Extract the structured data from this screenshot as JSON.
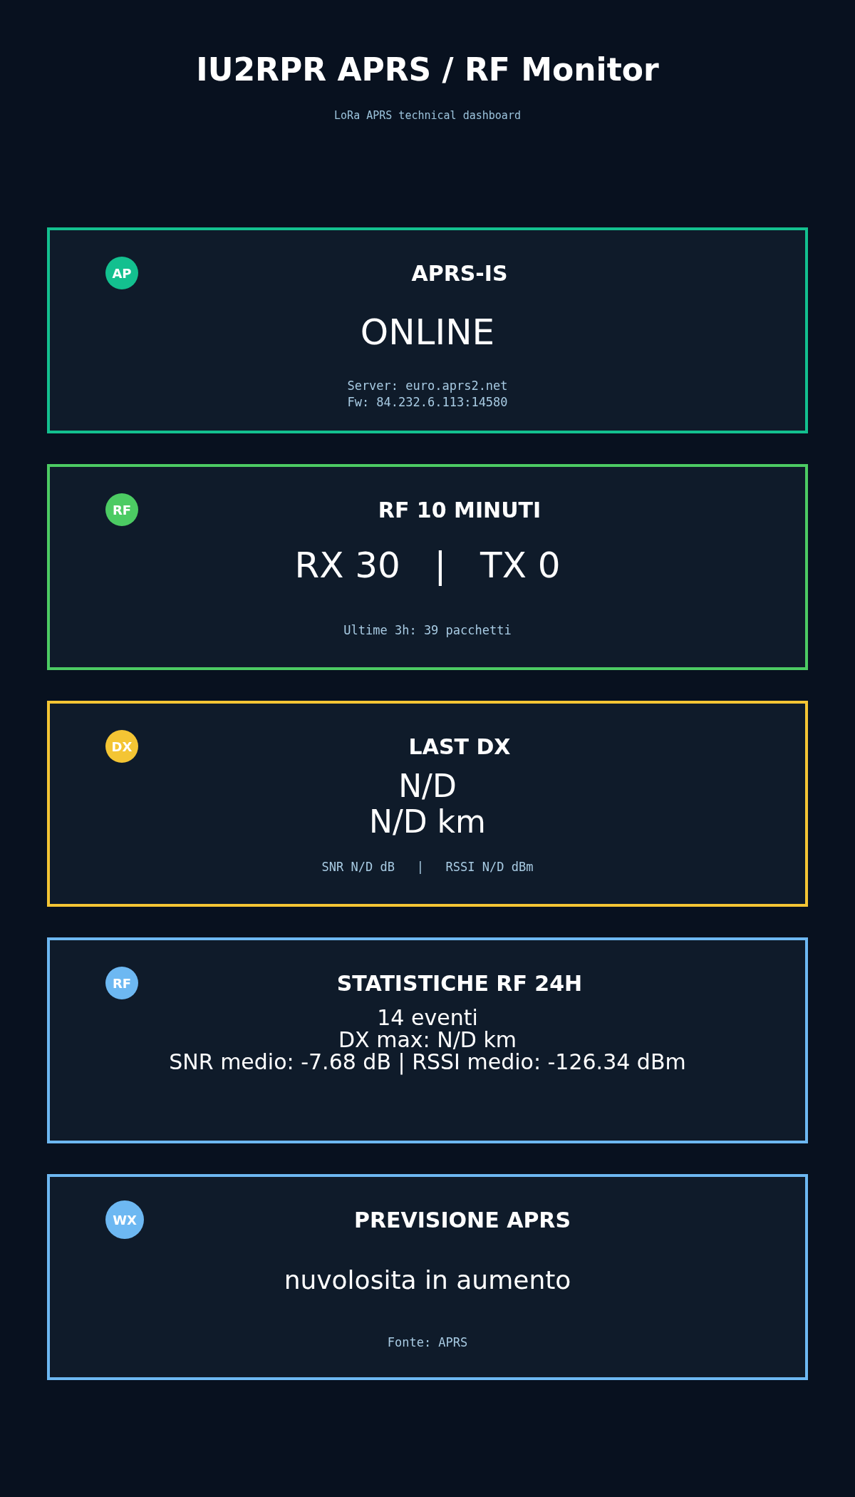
{
  "header": {
    "title": "IU2RPR APRS / RF Monitor",
    "subtitle": "LoRa APRS technical dashboard"
  },
  "cards": [
    {
      "kind": "status",
      "badge": "AP",
      "color": "#13c08f",
      "title": "APRS-IS",
      "values": [
        "ONLINE"
      ],
      "notes": [
        "Server: euro.aprs2.net",
        "Fw: 84.232.6.113:14580"
      ]
    },
    {
      "kind": "counter",
      "badge": "RF",
      "color": "#4ccb63",
      "title": "RF 10 MINUTI",
      "values": [
        "RX 30   |   TX 0"
      ],
      "notes": [
        "Ultime 3h: 39 pacchetti"
      ]
    },
    {
      "kind": "dx",
      "badge": "DX",
      "color": "#f4c534",
      "title": "LAST DX",
      "values": [
        "N/D",
        "N/D km"
      ],
      "notes": [
        "SNR N/D dB   |   RSSI N/D dBm"
      ]
    },
    {
      "kind": "stats",
      "badge": "RF",
      "color": "#6db8f2",
      "title": "STATISTICHE RF 24H",
      "values": [
        "14 eventi",
        "DX max: N/D km",
        "SNR medio: -7.68 dB | RSSI medio: -126.34 dBm"
      ]
    },
    {
      "kind": "forecast",
      "badge": "WX",
      "color": "#6db8f2",
      "title": "PREVISIONE APRS",
      "values": [
        "nuvolosita in aumento"
      ],
      "notes": [
        "Fonte: APRS"
      ]
    }
  ]
}
